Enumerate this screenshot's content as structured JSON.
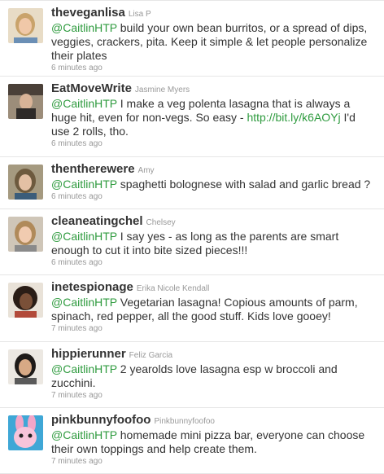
{
  "tweets": [
    {
      "username": "theveganlisa",
      "realname": "Lisa P",
      "mention": "@CaitlinHTP",
      "text": "build your own bean burritos, or a spread of dips, veggies, crackers, pita. Keep it simple & let people personalize their plates",
      "time": "6 minutes ago",
      "avatar_bg": "#c9a36b"
    },
    {
      "username": "EatMoveWrite",
      "realname": "Jasmine Myers",
      "mention": "@CaitlinHTP",
      "text": "I make a veg polenta lasagna that is always a huge hit, even for non-vegs. So easy -",
      "link": "http://bit.ly/k6AOYj",
      "text_after": "I'd use 2 rolls, tho.",
      "time": "6 minutes ago",
      "avatar_bg": "#5b4a3e"
    },
    {
      "username": "thentherewere",
      "realname": "Amy",
      "mention": "@CaitlinHTP",
      "text": "spaghetti bolognese with salad and garlic bread ?",
      "time": "6 minutes ago",
      "avatar_bg": "#7a6a48"
    },
    {
      "username": "cleaneatingchel",
      "realname": "Chelsey",
      "mention": "@CaitlinHTP",
      "text": "I say yes - as long as the parents are smart enough to cut it into bite sized pieces!!!",
      "time": "6 minutes ago",
      "avatar_bg": "#b9a58a"
    },
    {
      "username": "inetespionage",
      "realname": "Erika Nicole Kendall",
      "mention": "@CaitlinHTP",
      "text": "Vegetarian lasagna! Copious amounts of parm, spinach, red pepper, all the good stuff. Kids love gooey!",
      "time": "7 minutes ago",
      "avatar_bg": "#3a2b22"
    },
    {
      "username": "hippierunner",
      "realname": "Feliz Garcia",
      "mention": "@CaitlinHTP",
      "text": "2 yearolds love lasagna esp w broccoli and zucchini.",
      "time": "7 minutes ago",
      "avatar_bg": "#d8d2c8"
    },
    {
      "username": "pinkbunnyfoofoo",
      "realname": "Pinkbunnyfoofoo",
      "mention": "@CaitlinHTP",
      "text": "homemade mini pizza bar, everyone can choose their own toppings and help create them.",
      "time": "7 minutes ago",
      "avatar_bg": "#3fa7d6"
    }
  ],
  "colors": {
    "link": "#2f9b3f",
    "username": "#333333",
    "meta": "#999999",
    "divider": "#e6e6e6"
  },
  "icons": [
    "user-avatar-photo"
  ]
}
